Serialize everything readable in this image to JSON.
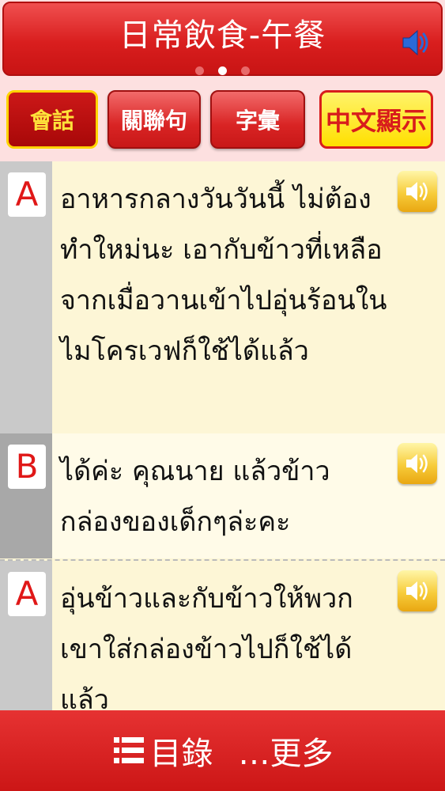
{
  "header": {
    "title": "日常飲食-午餐",
    "speaker_icon": "speaker-icon",
    "page_dots": 3,
    "active_dot": 1
  },
  "tabs": [
    {
      "label": "會話",
      "state": "selected"
    },
    {
      "label": "關聯句",
      "state": "normal"
    },
    {
      "label": "字彙",
      "state": "normal"
    },
    {
      "label": "中文顯示",
      "state": "toggle"
    }
  ],
  "dialogue": [
    {
      "speaker": "A",
      "text": "อาหารกลางวันวันนี้ ไม่ต้องทำใหม่นะ เอากับข้าวที่เหลือจากเมื่อวานเข้าไปอุ่นร้อนในไมโครเวฟก็ใช้ได้แล้ว"
    },
    {
      "speaker": "B",
      "text": "ได้ค่ะ คุณนาย แล้วข้าวกล่องของเด็กๆล่ะคะ"
    },
    {
      "speaker": "A",
      "text": "อุ่นข้าวและกับข้าวให้พวกเขาใส่กล่องข้าวไปก็ใช้ได้แล้ว"
    }
  ],
  "footer": {
    "menu_label": "目錄",
    "more_label": "…更多"
  },
  "colors": {
    "primary_red": "#d91e1e",
    "accent_yellow": "#ffe000",
    "list_bg": "#fdf6d6",
    "gutter_gray": "#c9c9c9"
  }
}
